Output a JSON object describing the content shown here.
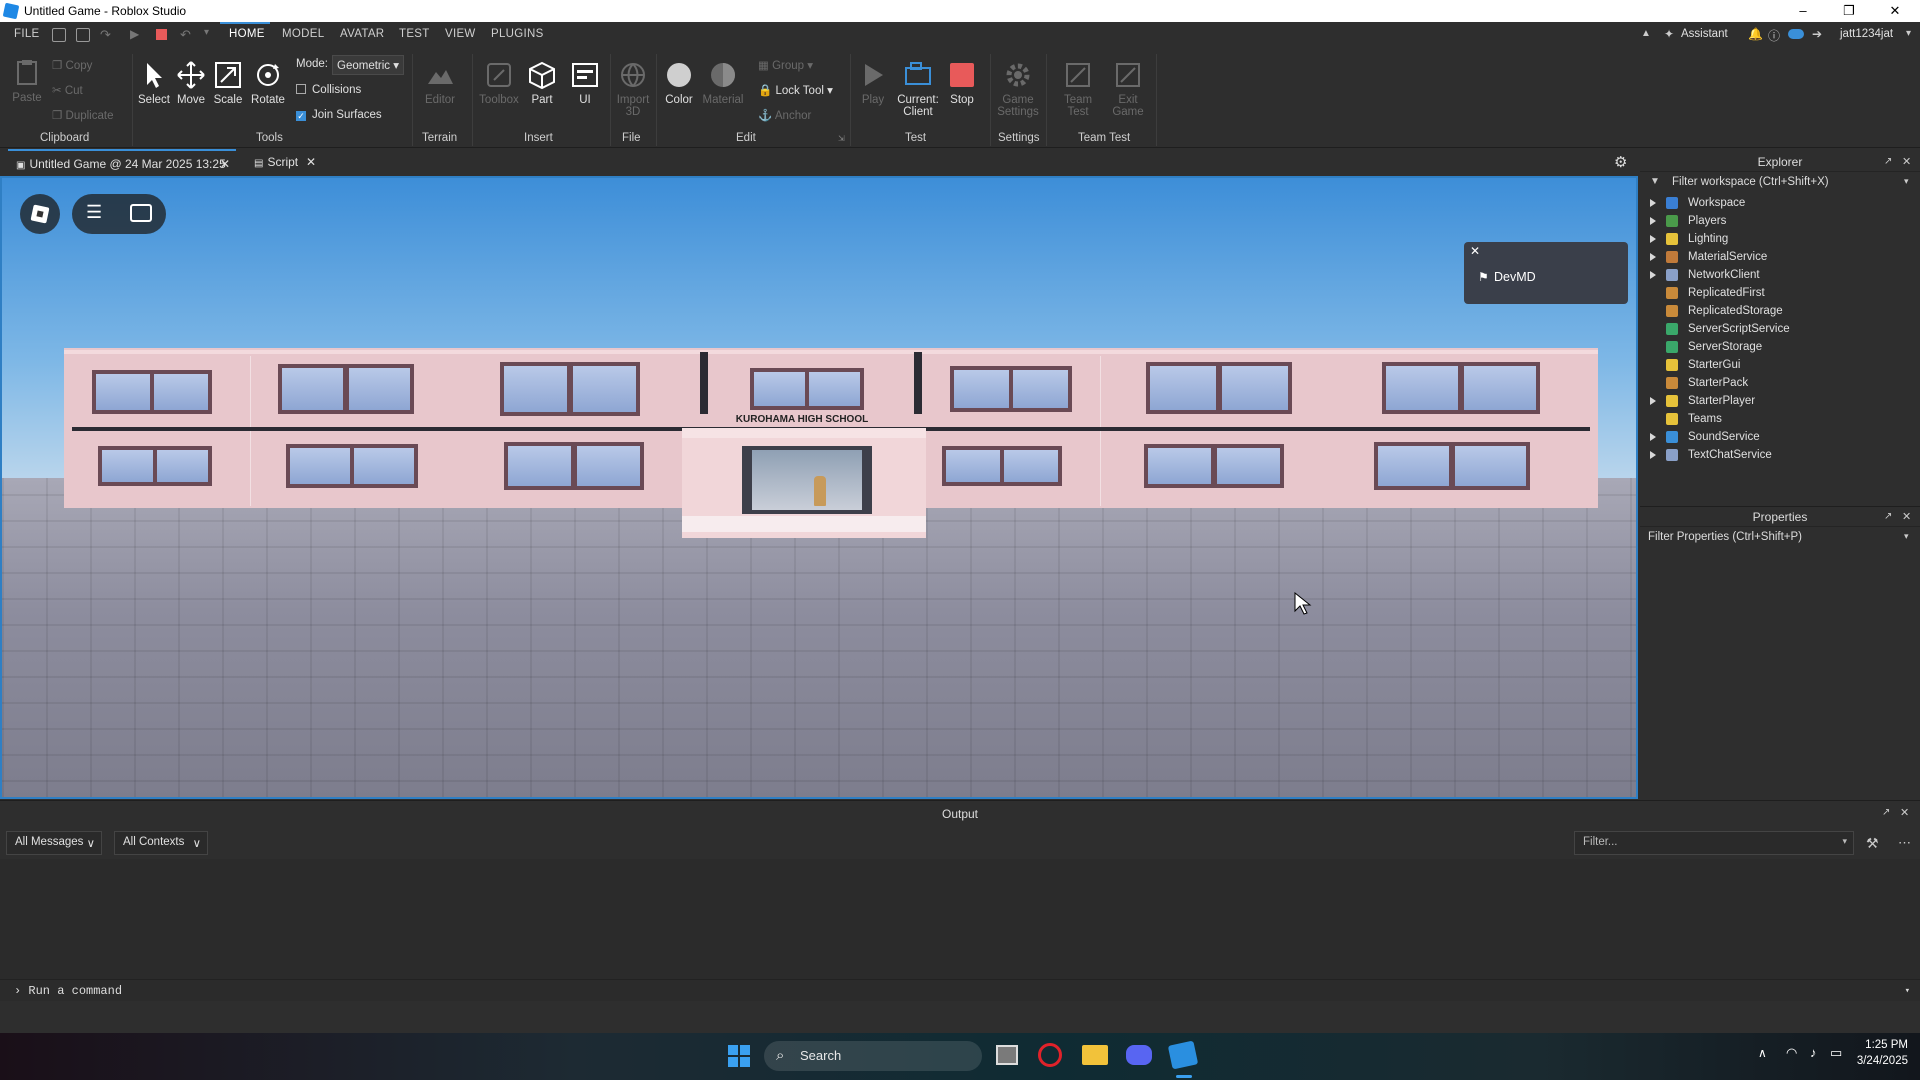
{
  "window": {
    "title": "Untitled Game - Roblox Studio"
  },
  "menubar": {
    "file": "FILE",
    "tabs": [
      "HOME",
      "MODEL",
      "AVATAR",
      "TEST",
      "VIEW",
      "PLUGINS"
    ],
    "assistant": "Assistant",
    "username": "jatt1234jat"
  },
  "ribbon": {
    "clipboard": {
      "paste": "Paste",
      "copy": "Copy",
      "cut": "Cut",
      "duplicate": "Duplicate",
      "label": "Clipboard"
    },
    "tools": {
      "select": "Select",
      "move": "Move",
      "scale": "Scale",
      "rotate": "Rotate",
      "mode_label": "Mode:",
      "mode_value": "Geometric",
      "collisions": "Collisions",
      "join_surfaces": "Join Surfaces",
      "label": "Tools"
    },
    "terrain": {
      "editor": "Editor",
      "label": "Terrain"
    },
    "insert": {
      "toolbox": "Toolbox",
      "part": "Part",
      "ui": "UI",
      "label": "Insert"
    },
    "file": {
      "import3d_1": "Import",
      "import3d_2": "3D",
      "label": "File"
    },
    "edit": {
      "color": "Color",
      "material": "Material",
      "group": "Group",
      "lock_tool": "Lock Tool",
      "anchor": "Anchor",
      "label": "Edit"
    },
    "test": {
      "play": "Play",
      "current_1": "Current:",
      "current_2": "Client",
      "stop": "Stop",
      "label": "Test"
    },
    "settings": {
      "game_1": "Game",
      "game_2": "Settings",
      "label": "Settings"
    },
    "team_test": {
      "team_1": "Team",
      "team_2": "Test",
      "exit_1": "Exit",
      "exit_2": "Game",
      "label": "Team Test"
    }
  },
  "doc_tabs": [
    "Untitled Game @ 24 Mar 2025 13:25",
    "Script"
  ],
  "viewport": {
    "sign_text": "KUROHAMA HIGH SCHOOL",
    "popup_name": "DevMD"
  },
  "explorer": {
    "title": "Explorer",
    "filter": "Filter workspace (Ctrl+Shift+X)",
    "items": [
      {
        "label": "Workspace",
        "expandable": true,
        "color": "#3a7fd4"
      },
      {
        "label": "Players",
        "expandable": true,
        "color": "#4a9a4a"
      },
      {
        "label": "Lighting",
        "expandable": true,
        "color": "#e6c23a"
      },
      {
        "label": "MaterialService",
        "expandable": true,
        "color": "#c07a3a"
      },
      {
        "label": "NetworkClient",
        "expandable": true,
        "color": "#8aa0c8"
      },
      {
        "label": "ReplicatedFirst",
        "expandable": false,
        "color": "#c98a3a"
      },
      {
        "label": "ReplicatedStorage",
        "expandable": false,
        "color": "#c98a3a"
      },
      {
        "label": "ServerScriptService",
        "expandable": false,
        "color": "#3aa86a"
      },
      {
        "label": "ServerStorage",
        "expandable": false,
        "color": "#3aa86a"
      },
      {
        "label": "StarterGui",
        "expandable": false,
        "color": "#e6c23a"
      },
      {
        "label": "StarterPack",
        "expandable": false,
        "color": "#c98a3a"
      },
      {
        "label": "StarterPlayer",
        "expandable": true,
        "color": "#e6c23a"
      },
      {
        "label": "Teams",
        "expandable": false,
        "color": "#e6c23a"
      },
      {
        "label": "SoundService",
        "expandable": true,
        "color": "#3a8fd8"
      },
      {
        "label": "TextChatService",
        "expandable": true,
        "color": "#8aa0c8"
      }
    ]
  },
  "properties": {
    "title": "Properties",
    "filter": "Filter Properties (Ctrl+Shift+P)"
  },
  "output": {
    "title": "Output",
    "messages_filter": "All Messages",
    "contexts_filter": "All Contexts",
    "filter_placeholder": "Filter...",
    "command_placeholder": "Run a command"
  },
  "taskbar": {
    "search": "Search",
    "time": "1:25 PM",
    "date": "3/24/2025"
  },
  "colors": {
    "accent": "#3a8fd8",
    "stop": "#e85a5a"
  }
}
